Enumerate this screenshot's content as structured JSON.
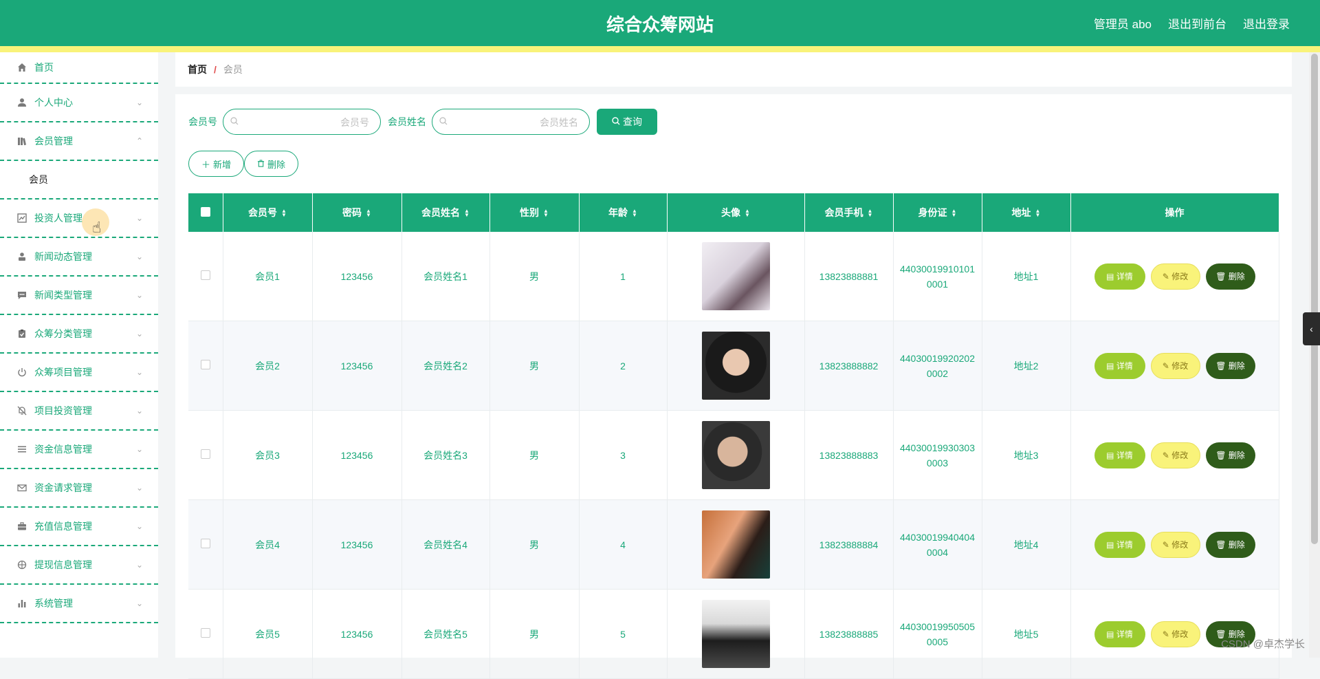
{
  "header": {
    "title": "综合众筹网站",
    "links": [
      "管理员 abo",
      "退出到前台",
      "退出登录"
    ]
  },
  "sidebar": {
    "items": [
      {
        "label": "首页",
        "icon": "home-icon"
      },
      {
        "label": "个人中心",
        "icon": "user-icon"
      },
      {
        "label": "会员管理",
        "icon": "library-icon",
        "expanded": true,
        "sub": "会员"
      },
      {
        "label": "投资人管理",
        "icon": "chart-icon"
      },
      {
        "label": "新闻动态管理",
        "icon": "person-icon"
      },
      {
        "label": "新闻类型管理",
        "icon": "chat-icon"
      },
      {
        "label": "众筹分类管理",
        "icon": "clipboard-icon"
      },
      {
        "label": "众筹项目管理",
        "icon": "power-icon"
      },
      {
        "label": "项目投资管理",
        "icon": "bell-off-icon"
      },
      {
        "label": "资金信息管理",
        "icon": "list-icon"
      },
      {
        "label": "资金请求管理",
        "icon": "mail-icon"
      },
      {
        "label": "充值信息管理",
        "icon": "briefcase-icon"
      },
      {
        "label": "提现信息管理",
        "icon": "target-icon"
      },
      {
        "label": "系统管理",
        "icon": "bar-chart-icon"
      }
    ]
  },
  "breadcrumb": {
    "home": "首页",
    "sep": "/",
    "current": "会员"
  },
  "search": {
    "label1": "会员号",
    "placeholder1": "会员号",
    "label2": "会员姓名",
    "placeholder2": "会员姓名",
    "button": "查询"
  },
  "actions": {
    "add": "新增",
    "delete": "删除"
  },
  "table": {
    "columns": [
      "会员号",
      "密码",
      "会员姓名",
      "性别",
      "年龄",
      "头像",
      "会员手机",
      "身份证",
      "地址",
      "操作"
    ],
    "rows": [
      {
        "id": "会员1",
        "pwd": "123456",
        "name": "会员姓名1",
        "sex": "男",
        "age": "1",
        "phone": "13823888881",
        "idcard": "440300199101010001",
        "addr": "地址1"
      },
      {
        "id": "会员2",
        "pwd": "123456",
        "name": "会员姓名2",
        "sex": "男",
        "age": "2",
        "phone": "13823888882",
        "idcard": "440300199202020002",
        "addr": "地址2"
      },
      {
        "id": "会员3",
        "pwd": "123456",
        "name": "会员姓名3",
        "sex": "男",
        "age": "3",
        "phone": "13823888883",
        "idcard": "440300199303030003",
        "addr": "地址3"
      },
      {
        "id": "会员4",
        "pwd": "123456",
        "name": "会员姓名4",
        "sex": "男",
        "age": "4",
        "phone": "13823888884",
        "idcard": "440300199404040004",
        "addr": "地址4"
      },
      {
        "id": "会员5",
        "pwd": "123456",
        "name": "会员姓名5",
        "sex": "男",
        "age": "5",
        "phone": "13823888885",
        "idcard": "440300199505050005",
        "addr": "地址5"
      }
    ],
    "ops": {
      "detail": "详情",
      "edit": "修改",
      "delete": "删除"
    }
  },
  "watermark": "CSDN @卓杰学长",
  "colors": {
    "primary": "#1aa879",
    "accent_strip": "#f9f37a",
    "detail": "#9ccc2e",
    "edit": "#f9f37a",
    "delete": "#2f5c1a"
  }
}
